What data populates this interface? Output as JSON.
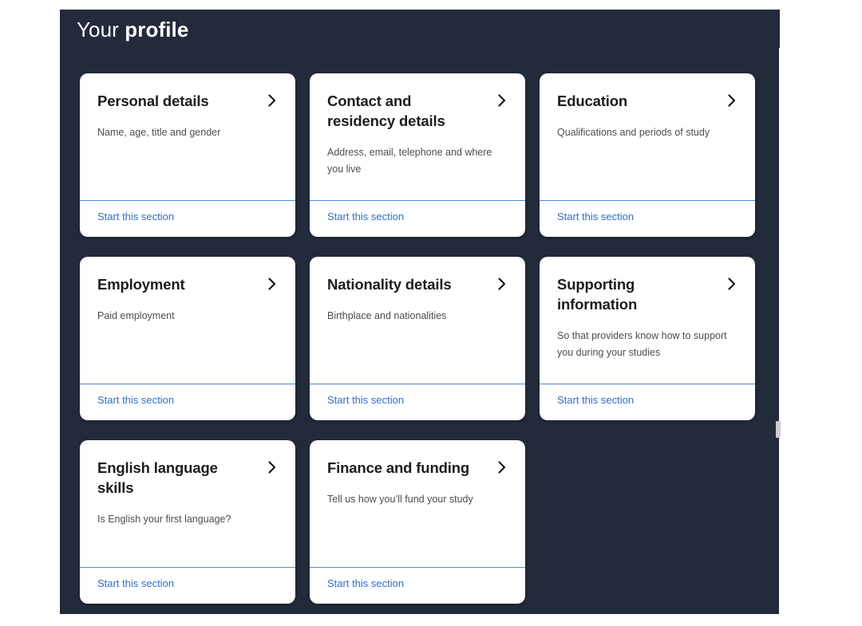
{
  "page": {
    "title_light": "Your ",
    "title_strong": "profile",
    "background_color": "#232b3b",
    "card_background": "#ffffff",
    "accent_color": "#4f8ad8",
    "link_color": "#2f6fd0"
  },
  "icons": {
    "chevron_right": "chevron-right-icon"
  },
  "cards": [
    {
      "title": "Personal details",
      "description": "Name, age, title and gender",
      "link": "Start this section"
    },
    {
      "title": "Contact and residency details",
      "description": "Address, email, telephone and where you live",
      "link": "Start this section"
    },
    {
      "title": "Education",
      "description": "Qualifications and periods of study",
      "link": "Start this section"
    },
    {
      "title": "Employment",
      "description": "Paid employment",
      "link": "Start this section"
    },
    {
      "title": "Nationality details",
      "description": "Birthplace and nationalities",
      "link": "Start this section"
    },
    {
      "title": "Supporting information",
      "description": "So that providers know how to support you during your studies",
      "link": "Start this section"
    },
    {
      "title": "English language skills",
      "description": "Is English your first language?",
      "link": "Start this section"
    },
    {
      "title": "Finance and funding",
      "description": "Tell us how you’ll fund your study",
      "link": "Start this section"
    }
  ],
  "scrollbar": {
    "orientation": "vertical",
    "thumb_color": "#c9cdd3"
  }
}
